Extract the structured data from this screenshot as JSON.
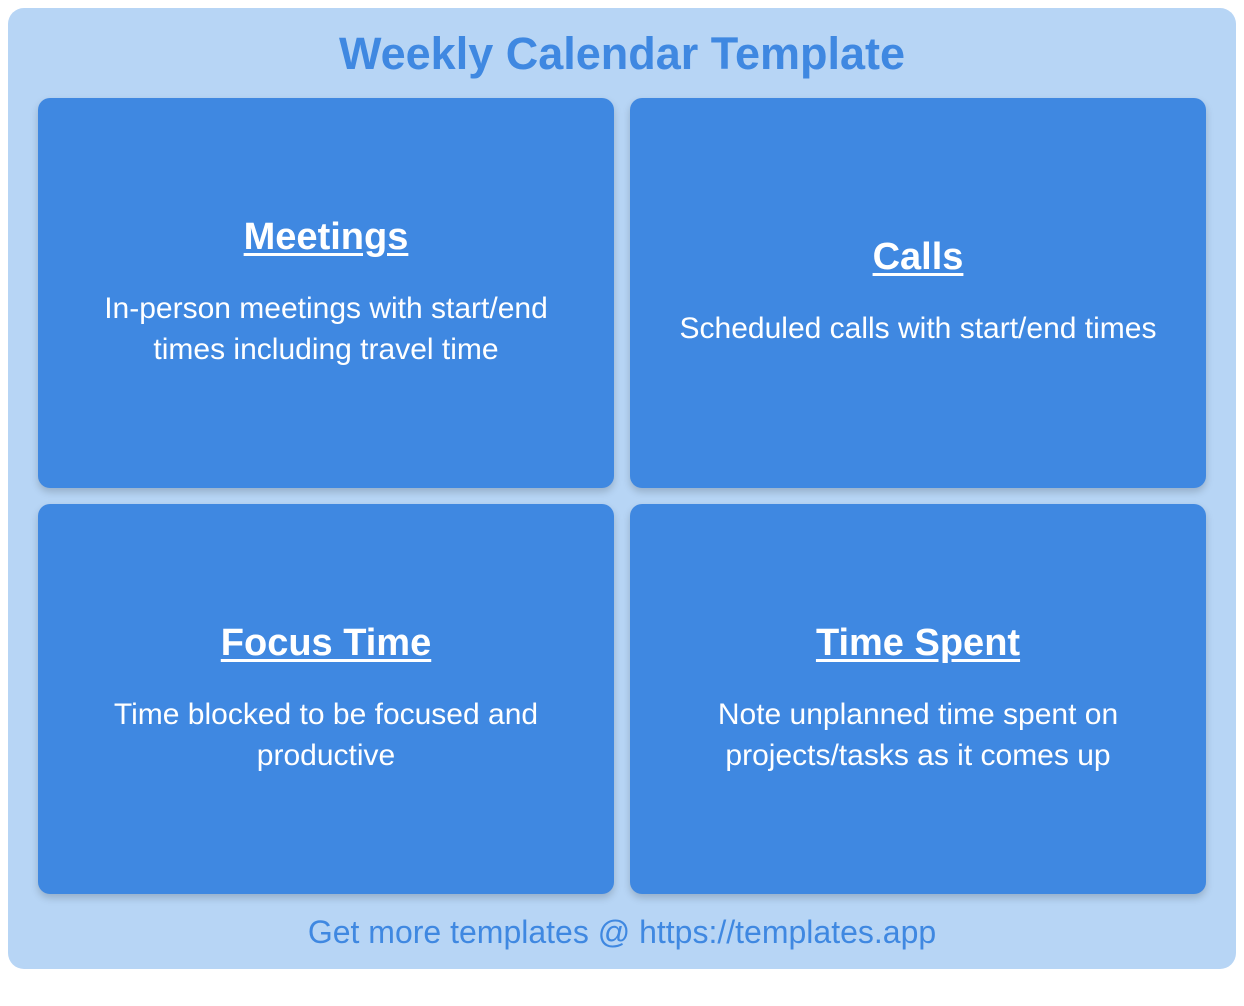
{
  "title": "Weekly Calendar Template",
  "cards": [
    {
      "title": "Meetings",
      "desc": "In-person meetings with start/end times including travel time"
    },
    {
      "title": "Calls",
      "desc": "Scheduled calls with start/end times"
    },
    {
      "title": "Focus Time",
      "desc": "Time blocked to be focused and productive"
    },
    {
      "title": "Time Spent",
      "desc": "Note unplanned time spent on projects/tasks as it comes up"
    }
  ],
  "footer": "Get more templates @ https://templates.app"
}
